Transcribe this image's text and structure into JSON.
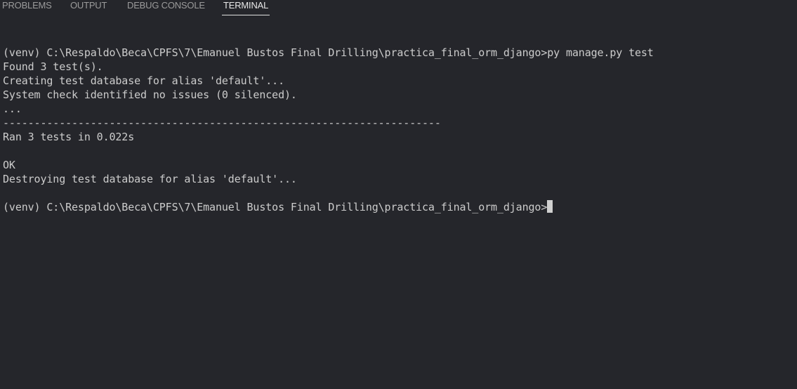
{
  "panel": {
    "tabs": {
      "problems": "PROBLEMS",
      "output": "OUTPUT",
      "debug_console": "DEBUG CONSOLE",
      "terminal": "TERMINAL"
    },
    "active_tab": "TERMINAL"
  },
  "terminal": {
    "lines": {
      "command": "(venv) C:\\Respaldo\\Beca\\CPFS\\7\\Emanuel Bustos Final Drilling\\practica_final_orm_django>py manage.py test",
      "found": "Found 3 test(s).",
      "creating": "Creating test database for alias 'default'...",
      "system_check": "System check identified no issues (0 silenced).",
      "dots": "...",
      "separator": "----------------------------------------------------------------------",
      "ran": "Ran 3 tests in 0.022s",
      "ok": "OK",
      "destroying": "Destroying test database for alias 'default'...",
      "prompt": "(venv) C:\\Respaldo\\Beca\\CPFS\\7\\Emanuel Bustos Final Drilling\\practica_final_orm_django>"
    }
  },
  "colors": {
    "background": "#25262b",
    "text": "#cccccc",
    "tab_inactive": "#9b9b9b",
    "tab_active": "#e8e8e8"
  }
}
